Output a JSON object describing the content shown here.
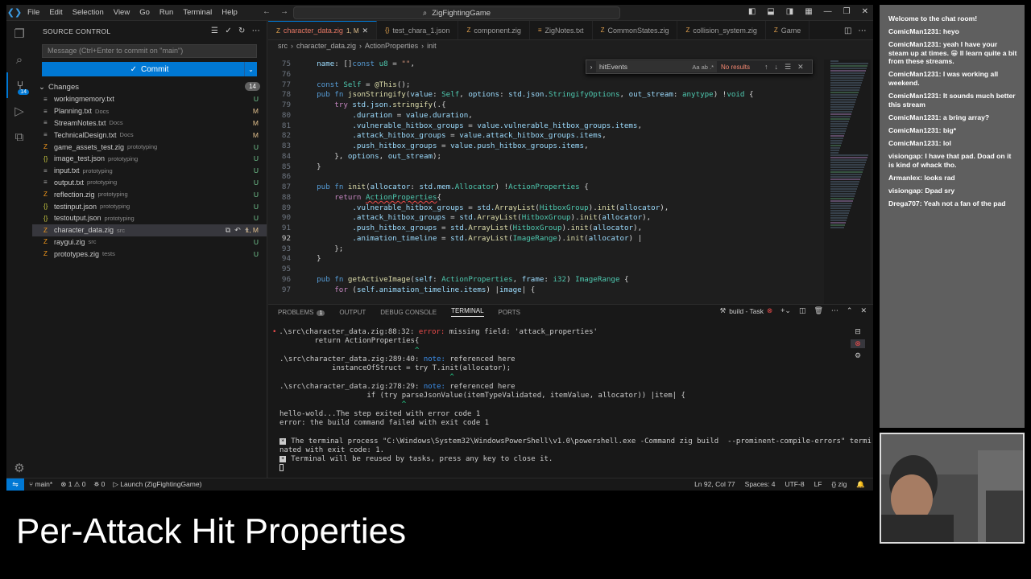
{
  "titlebar": {
    "menu": [
      "File",
      "Edit",
      "Selection",
      "View",
      "Go",
      "Run",
      "Terminal",
      "Help"
    ],
    "command_center": "ZigFightingGame"
  },
  "sidebar": {
    "title": "SOURCE CONTROL",
    "commit_placeholder": "Message (Ctrl+Enter to commit on \"main\")",
    "commit_label": "Commit",
    "changes_label": "Changes",
    "changes_count": "14",
    "files": [
      {
        "name": "workingmemory.txt",
        "dir": "",
        "status": "U"
      },
      {
        "name": "Planning.txt",
        "dir": "Docs",
        "status": "M"
      },
      {
        "name": "StreamNotes.txt",
        "dir": "Docs",
        "status": "M"
      },
      {
        "name": "TechnicalDesign.txt",
        "dir": "Docs",
        "status": "M"
      },
      {
        "name": "game_assets_test.zig",
        "dir": "prototyping",
        "status": "U"
      },
      {
        "name": "image_test.json",
        "dir": "prototyping",
        "status": "U"
      },
      {
        "name": "input.txt",
        "dir": "prototyping",
        "status": "U"
      },
      {
        "name": "output.txt",
        "dir": "prototyping",
        "status": "U"
      },
      {
        "name": "reflection.zig",
        "dir": "prototyping",
        "status": "U"
      },
      {
        "name": "testinput.json",
        "dir": "prototyping",
        "status": "U"
      },
      {
        "name": "testoutput.json",
        "dir": "prototyping",
        "status": "U"
      },
      {
        "name": "character_data.zig",
        "dir": "src",
        "status": "1, M"
      },
      {
        "name": "raygui.zig",
        "dir": "src",
        "status": "U"
      },
      {
        "name": "prototypes.zig",
        "dir": "tests",
        "status": "U"
      }
    ]
  },
  "editor": {
    "tabs": [
      {
        "label": "character_data.zig",
        "mod": "1, M"
      },
      {
        "label": "test_chara_1.json",
        "mod": ""
      },
      {
        "label": "component.zig",
        "mod": ""
      },
      {
        "label": "ZigNotes.txt",
        "mod": ""
      },
      {
        "label": "CommonStates.zig",
        "mod": ""
      },
      {
        "label": "collision_system.zig",
        "mod": ""
      },
      {
        "label": "Game",
        "mod": ""
      }
    ],
    "breadcrumb": [
      "src",
      "character_data.zig",
      "ActionProperties",
      "init"
    ],
    "find": {
      "query": "hitEvents",
      "options": "Aa ab .*",
      "result": "No results"
    },
    "line_numbers": [
      "75",
      "76",
      "77",
      "78",
      "79",
      "80",
      "81",
      "82",
      "83",
      "84",
      "85",
      "86",
      "87",
      "88",
      "89",
      "90",
      "91",
      "92",
      "93",
      "94",
      "95",
      "96",
      "97"
    ],
    "current_line": "92"
  },
  "panel": {
    "tabs": [
      "PROBLEMS",
      "OUTPUT",
      "DEBUG CONSOLE",
      "TERMINAL",
      "PORTS"
    ],
    "problems_count": "1",
    "task": "build - Task",
    "terminal_lines": [
      {
        "t": "err",
        "file": ".\\src\\character_data.zig:88:32: ",
        "kind": "error: ",
        "msg": "missing field: 'attack_properties'"
      },
      {
        "t": "plain",
        "text": "        return ActionProperties{"
      },
      {
        "t": "caret",
        "text": "                               ^"
      },
      {
        "t": "note",
        "file": ".\\src\\character_data.zig:289:40: ",
        "kind": "note: ",
        "msg": "referenced here"
      },
      {
        "t": "plain",
        "text": "            instanceOfStruct = try T.init(allocator);"
      },
      {
        "t": "caret",
        "text": "                                       ^"
      },
      {
        "t": "note",
        "file": ".\\src\\character_data.zig:278:29: ",
        "kind": "note: ",
        "msg": "referenced here"
      },
      {
        "t": "plain",
        "text": "                    if (try parseJsonValue(itemTypeValidated, itemValue, allocator)) |item| {"
      },
      {
        "t": "caret",
        "text": "                            ^"
      },
      {
        "t": "plain",
        "text": "hello-wold...The step exited with error code 1"
      },
      {
        "t": "plain",
        "text": "error: the build command failed with exit code 1"
      },
      {
        "t": "blank",
        "text": ""
      },
      {
        "t": "mark",
        "text": "The terminal process \"C:\\Windows\\System32\\WindowsPowerShell\\v1.0\\powershell.exe -Command zig build  --prominent-compile-errors\" termi"
      },
      {
        "t": "plain",
        "text": "nated with exit code: 1."
      },
      {
        "t": "mark",
        "text": "Terminal will be reused by tasks, press any key to close it."
      }
    ]
  },
  "statusbar": {
    "branch": "main*",
    "errors": "1",
    "warnings": "0",
    "ports": "0",
    "launch": "Launch (ZigFightingGame)",
    "position": "Ln 92, Col 77",
    "spaces": "Spaces: 4",
    "encoding": "UTF-8",
    "eol": "LF",
    "language": "zig"
  },
  "chat": [
    "Welcome to the chat room!",
    "ComicMan1231: heyo",
    "ComicMan1231: yeah I have your steam up at times. 😁 Il learn quite a bit from these streams.",
    "ComicMan1231: I was working all weekend.",
    "ComicMan1231: It sounds much better this stream",
    "ComicMan1231: a bring array?",
    "ComicMan1231: big*",
    "ComicMan1231: lol",
    "visiongap: I have that pad. Doad on it is kind of whack tho.",
    "Armanlex: looks rad",
    "visiongap: Dpad sry",
    "Drega707: Yeah not a fan of the pad"
  ],
  "caption": "Per-Attack Hit Properties",
  "colors": {
    "accent": "#0078d4",
    "error": "#f14c4c",
    "chat_bg": "#5f5f5f"
  }
}
